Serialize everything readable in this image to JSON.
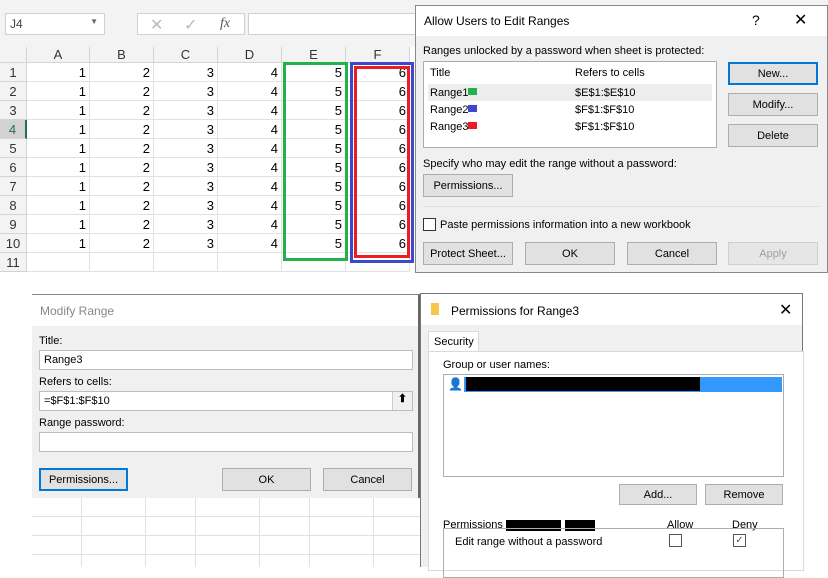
{
  "excel": {
    "name_box": "J4",
    "cancel_icon": "x-icon",
    "enter_icon": "check-icon",
    "fx_label": "fx",
    "columns": [
      "A",
      "B",
      "C",
      "D",
      "E",
      "F"
    ],
    "rows": [
      [
        "1",
        "2",
        "3",
        "4",
        "5",
        "6"
      ],
      [
        "1",
        "2",
        "3",
        "4",
        "5",
        "6"
      ],
      [
        "1",
        "2",
        "3",
        "4",
        "5",
        "6"
      ],
      [
        "1",
        "2",
        "3",
        "4",
        "5",
        "6"
      ],
      [
        "1",
        "2",
        "3",
        "4",
        "5",
        "6"
      ],
      [
        "1",
        "2",
        "3",
        "4",
        "5",
        "6"
      ],
      [
        "1",
        "2",
        "3",
        "4",
        "5",
        "6"
      ],
      [
        "1",
        "2",
        "3",
        "4",
        "5",
        "6"
      ],
      [
        "1",
        "2",
        "3",
        "4",
        "5",
        "6"
      ],
      [
        "1",
        "2",
        "3",
        "4",
        "5",
        "6"
      ]
    ],
    "row_numbers": [
      "1",
      "2",
      "3",
      "4",
      "5",
      "6",
      "7",
      "8",
      "9",
      "10",
      "11"
    ],
    "range_colors": {
      "range1": "#22b14c",
      "range2": "#3f48cc",
      "range3": "#ed1c24"
    }
  },
  "allow_dialog": {
    "title": "Allow Users to Edit Ranges",
    "help": "?",
    "list_label": "Ranges unlocked by a password when sheet is protected:",
    "col_title": "Title",
    "col_refers": "Refers to cells",
    "ranges": [
      {
        "title": "Range1",
        "refers": "$E$1:$E$10",
        "color": "#22b14c"
      },
      {
        "title": "Range2",
        "refers": "$F$1:$F$10",
        "color": "#3f48cc"
      },
      {
        "title": "Range3",
        "refers": "$F$1:$F$10",
        "color": "#ed1c24"
      }
    ],
    "new": "New...",
    "modify": "Modify...",
    "delete": "Delete",
    "specify_label": "Specify who may edit the range without a password:",
    "permissions": "Permissions...",
    "paste_label": "Paste permissions information into a new workbook",
    "protect": "Protect Sheet...",
    "ok": "OK",
    "cancel": "Cancel",
    "apply": "Apply"
  },
  "modify_dialog": {
    "title": "Modify Range",
    "title_label": "Title:",
    "title_value": "Range3",
    "refers_label": "Refers to cells:",
    "refers_value": "=$F$1:$F$10",
    "password_label": "Range password:",
    "password_value": "",
    "permissions": "Permissions...",
    "ok": "OK",
    "cancel": "Cancel"
  },
  "perm_dialog": {
    "title": "Permissions for Range3",
    "tab": "Security",
    "group_label": "Group or user names:",
    "add": "Add...",
    "remove": "Remove",
    "perm_for": "Permissions for",
    "allow": "Allow",
    "deny": "Deny",
    "permissions": [
      {
        "name": "Edit range without a password",
        "allow": false,
        "deny": true
      }
    ]
  }
}
